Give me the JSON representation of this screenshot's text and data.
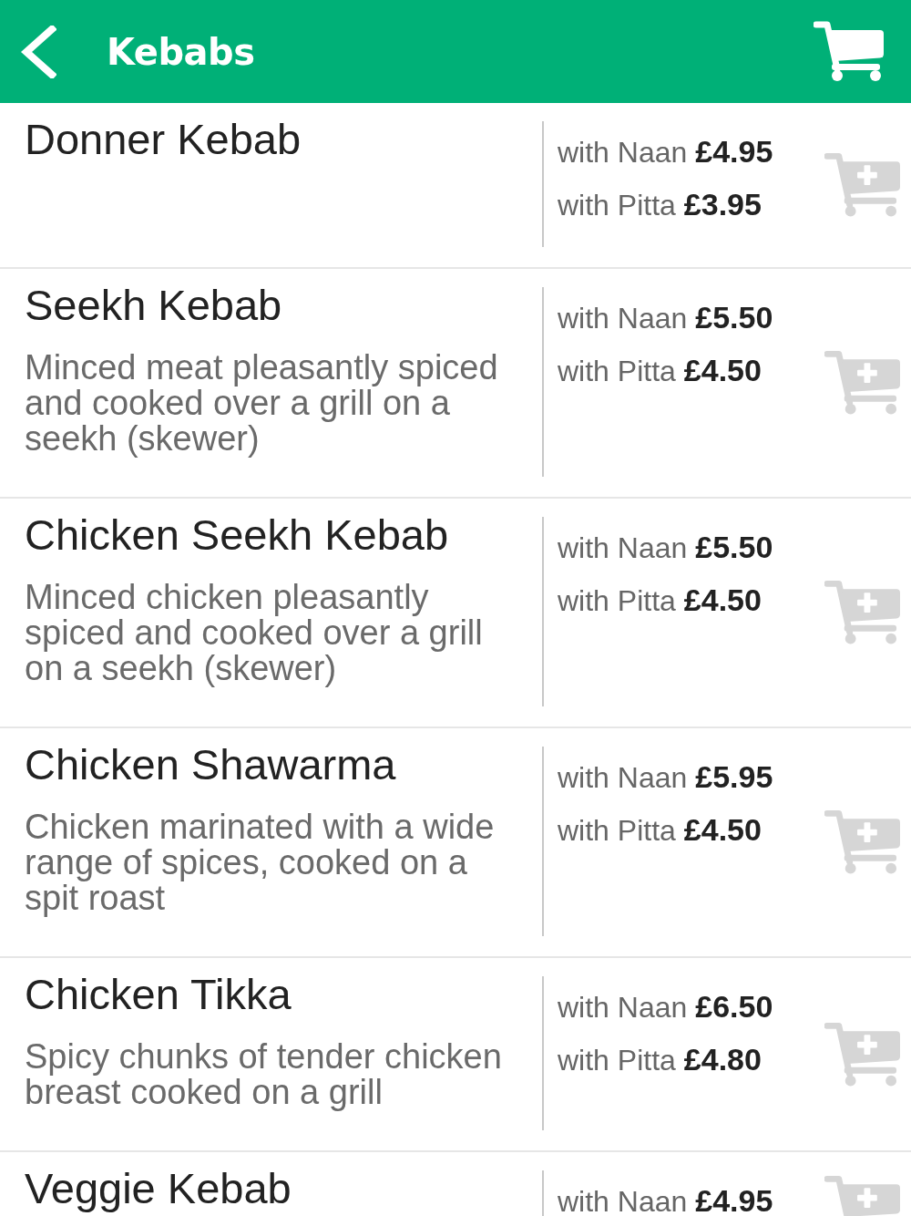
{
  "header": {
    "title": "Kebabs"
  },
  "items": [
    {
      "name": "Donner Kebab",
      "options": [
        {
          "label": "with Naan",
          "price": "£4.95"
        },
        {
          "label": "with Pitta",
          "price": "£3.95"
        }
      ]
    },
    {
      "name": "Seekh Kebab",
      "description": "Minced meat pleasantly spiced and cooked over a grill on a seekh (skewer)",
      "options": [
        {
          "label": "with Naan",
          "price": "£5.50"
        },
        {
          "label": "with Pitta",
          "price": "£4.50"
        }
      ]
    },
    {
      "name": "Chicken Seekh Kebab",
      "description": "Minced chicken pleasantly spiced and cooked over a grill on a seekh (skewer)",
      "options": [
        {
          "label": "with Naan",
          "price": "£5.50"
        },
        {
          "label": "with Pitta",
          "price": "£4.50"
        }
      ]
    },
    {
      "name": "Chicken Shawarma",
      "description": "Chicken marinated with a wide range of spices, cooked on a spit roast",
      "options": [
        {
          "label": "with Naan",
          "price": "£5.95"
        },
        {
          "label": "with Pitta",
          "price": "£4.50"
        }
      ]
    },
    {
      "name": "Chicken Tikka",
      "description": "Spicy chunks of tender chicken breast cooked on a grill",
      "options": [
        {
          "label": "with Naan",
          "price": "£6.50"
        },
        {
          "label": "with Pitta",
          "price": "£4.80"
        }
      ]
    },
    {
      "name": "Veggie Kebab",
      "options": [
        {
          "label": "with Naan",
          "price": "£4.95"
        }
      ]
    }
  ]
}
